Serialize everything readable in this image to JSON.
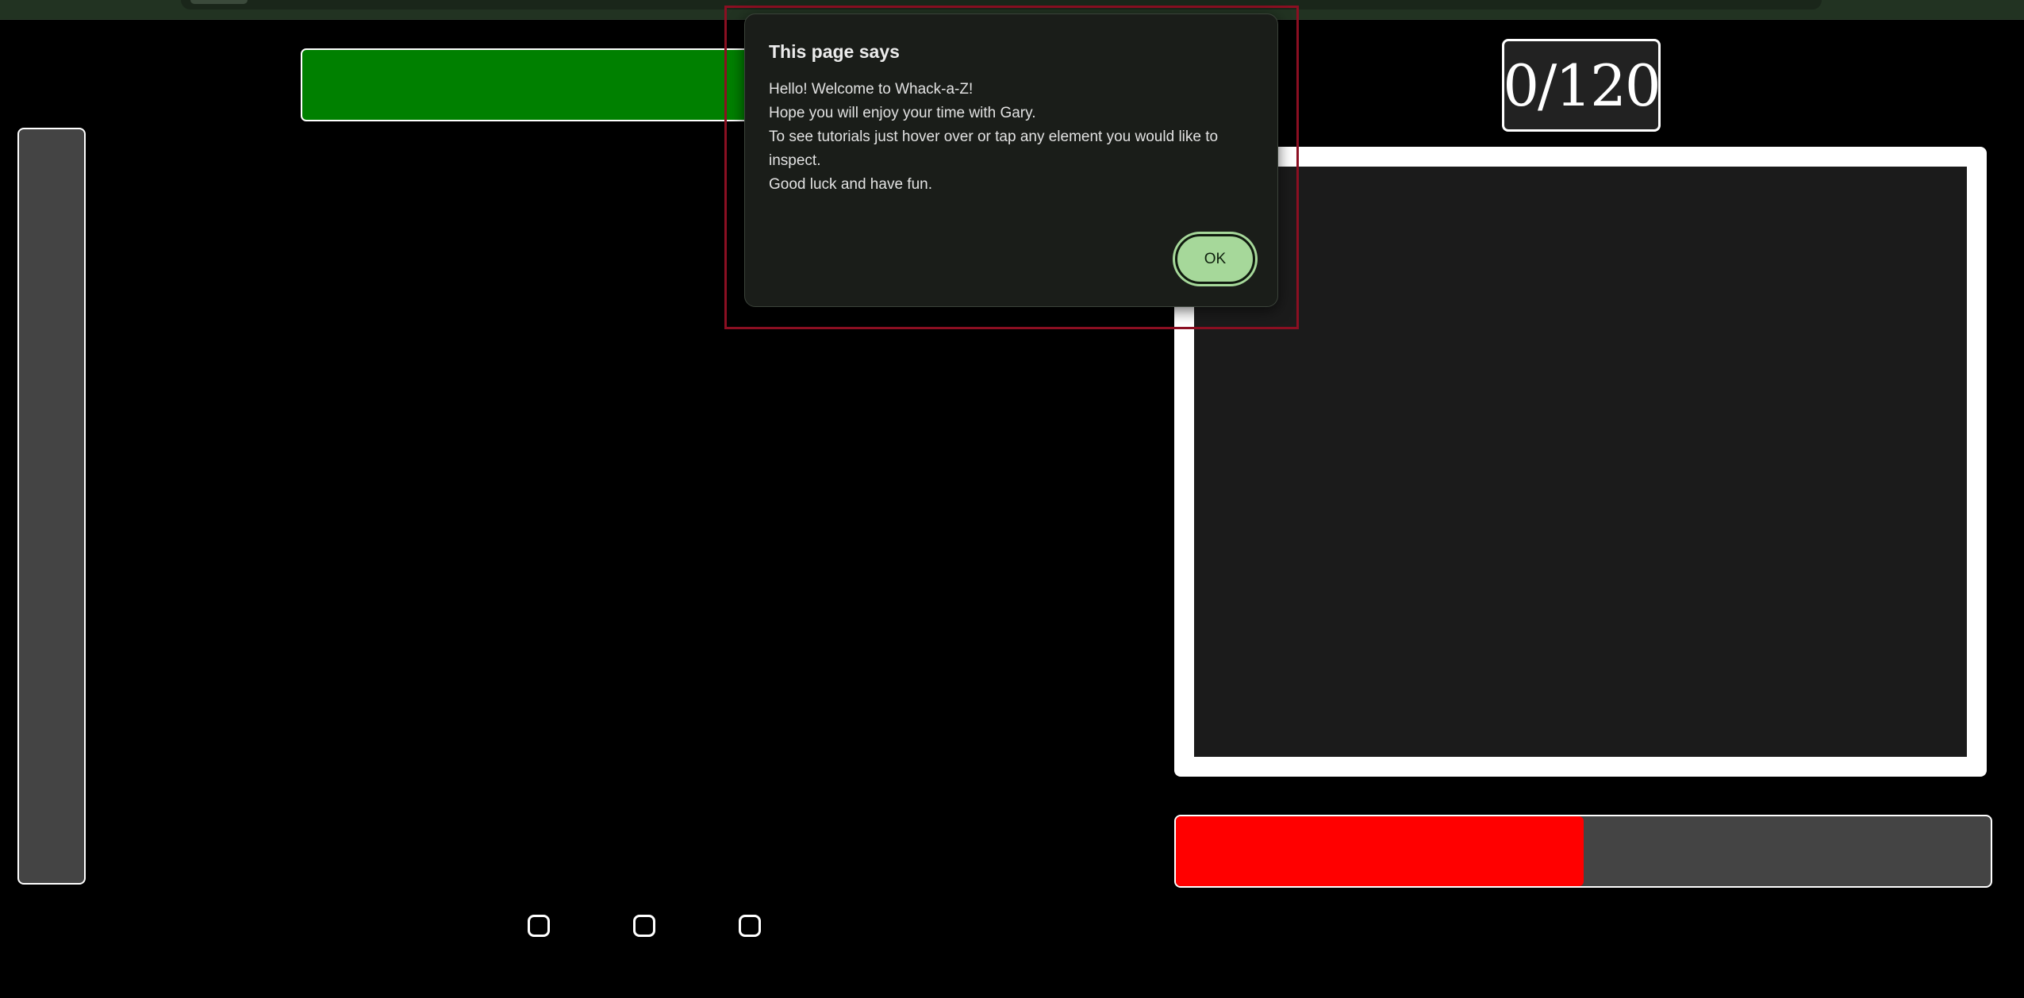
{
  "dialog": {
    "title": "This page says",
    "lines": [
      "Hello! Welcome to Whack-a-Z!",
      "Hope you will enjoy your time with Gary.",
      "To see tutorials just hover over or tap any element you would like to inspect.",
      "Good luck and have fun."
    ],
    "ok_label": "OK"
  },
  "score": {
    "text": "0/120"
  },
  "health": {
    "fraction": 0.5
  },
  "colors": {
    "background": "#000000",
    "green_bar": "#008000",
    "health_fill": "#ff0000",
    "panel_gray": "#444444",
    "ok_button": "#a6d89a",
    "highlight": "#8b0f22"
  }
}
